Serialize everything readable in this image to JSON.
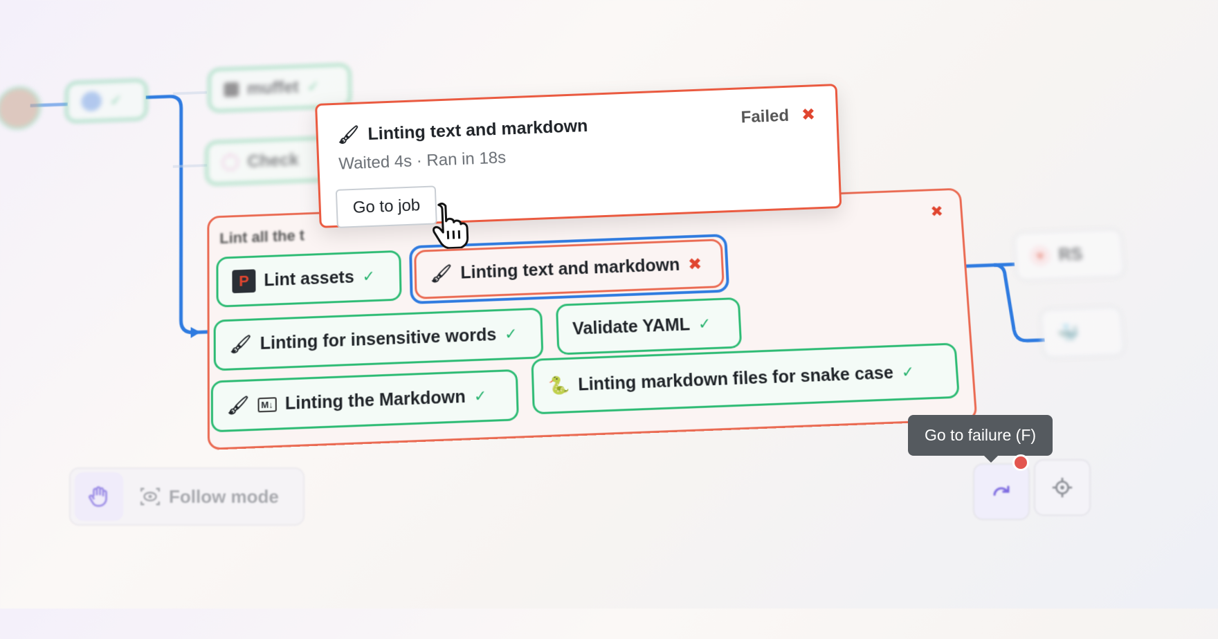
{
  "background_nodes": {
    "muffet_label": "muffet",
    "check_label": "Check"
  },
  "group": {
    "title": "Lint all the t"
  },
  "jobs": {
    "lint_assets": "Lint assets",
    "linting_text": "Linting text and markdown",
    "insensitive": "Linting for insensitive words",
    "validate_yaml": "Validate YAML",
    "linting_markdown": "Linting the Markdown",
    "snake_case": "Linting markdown files for snake case"
  },
  "popup": {
    "title": "Linting text and markdown",
    "subtitle": "Waited 4s · Ran in 18s",
    "status": "Failed",
    "button": "Go to job"
  },
  "right_nodes": {
    "rs_label": "RS"
  },
  "toolbar": {
    "follow_label": "Follow mode"
  },
  "tooltip": {
    "text": "Go to failure (F)"
  },
  "colors": {
    "success": "#22b16b",
    "failure": "#e0452f",
    "edge": "#2f7be0"
  },
  "icons": {
    "success": "check-icon",
    "failure": "close-icon",
    "lint": "brush-icon",
    "snake": "snake-icon",
    "markdown": "markdown-icon",
    "docker": "docker-icon",
    "follow": "eye-icon",
    "hand": "hand-icon"
  }
}
